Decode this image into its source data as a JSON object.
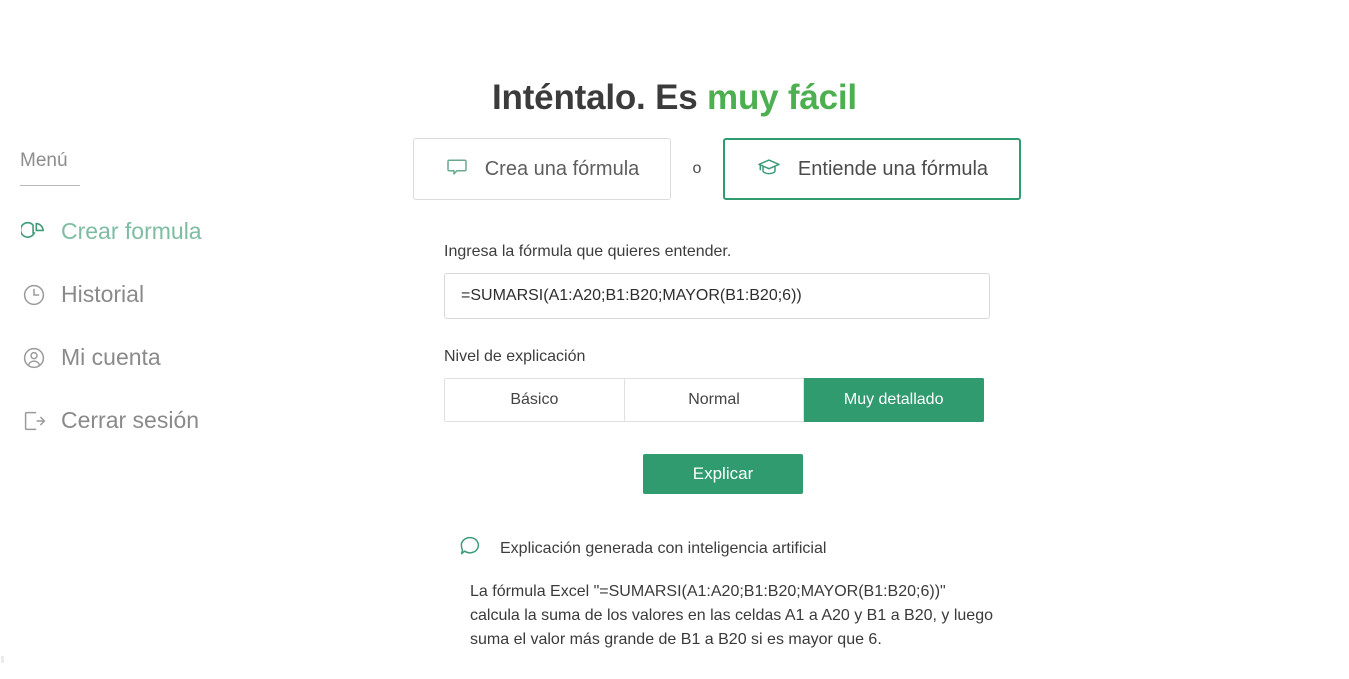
{
  "title": {
    "text_plain": "Inténtalo. Es ",
    "text_accent": "muy fácil",
    "accent_color": "#4caf50"
  },
  "sidebar": {
    "heading": "Menú",
    "items": [
      {
        "label": "Crear formula",
        "icon": "pie-chart-icon",
        "active": true
      },
      {
        "label": "Historial",
        "icon": "clock-icon",
        "active": false
      },
      {
        "label": "Mi cuenta",
        "icon": "user-circle-icon",
        "active": false
      },
      {
        "label": "Cerrar sesión",
        "icon": "logout-icon",
        "active": false
      }
    ]
  },
  "tabs": {
    "separator": "o",
    "create": {
      "label": "Crea una fórmula",
      "icon": "speech-bubble-icon",
      "selected": false
    },
    "understand": {
      "label": "Entiende una fórmula",
      "icon": "graduation-cap-icon",
      "selected": true
    }
  },
  "form": {
    "formula_label": "Ingresa la fórmula que quieres entender.",
    "formula_value": "=SUMARSI(A1:A20;B1:B20;MAYOR(B1:B20;6))",
    "formula_placeholder": "=SUMARSI(A1:A20;B1:B20;MAYOR(B1:B20;6))",
    "level_label": "Nivel de explicación",
    "levels": [
      {
        "label": "Básico",
        "selected": false
      },
      {
        "label": "Normal",
        "selected": false
      },
      {
        "label": "Muy detallado",
        "selected": true
      }
    ],
    "submit_label": "Explicar"
  },
  "explanation": {
    "header": "Explicación generada con inteligencia artificial",
    "header_icon": "speech-bubble-icon",
    "body": "La fórmula Excel \"=SUMARSI(A1:A20;B1:B20;MAYOR(B1:B20;6))\" calcula la suma de los valores en las celdas A1 a A20 y B1 a B20, y luego suma el valor más grande de B1 a B20 si es mayor que 6."
  },
  "colors": {
    "brand_green": "#2f9b6f",
    "title_green": "#4caf50",
    "active_item": "#7dbda2",
    "muted_text": "#8a8a8a"
  }
}
